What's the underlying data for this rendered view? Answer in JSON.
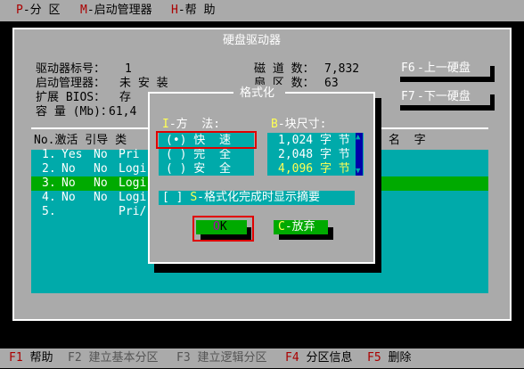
{
  "menu": {
    "item1_key": "P",
    "item1_label": "-分 区",
    "item2_key": "M",
    "item2_label": "-启动管理器",
    "item3_key": "H",
    "item3_label": "-帮 助"
  },
  "disk_panel": {
    "title": "硬盘驱动器",
    "drive_label": "驱动器标号：",
    "drive_value": "1",
    "boot_label": "启动管理器：",
    "boot_value": "未 安 装",
    "bios_label": "扩展 BIOS：",
    "bios_value": "存",
    "capacity_label": "容 量 (Mb)：",
    "capacity_value": "61,4",
    "cylinders_label": "磁 道 数：",
    "cylinders_value": "7,832",
    "heads_label": "扇 区 数：",
    "heads_value": "63",
    "btn_prev_key": "F6",
    "btn_prev_label": "-上一硬盘",
    "btn_next_key": "F7",
    "btn_next_label": "-下一硬盘"
  },
  "partition_list": {
    "header_left": "No.激活 引导 类",
    "header_right": "名  字",
    "rows": [
      {
        "no": "1.",
        "active": "Yes",
        "boot": "No",
        "type": "Pri"
      },
      {
        "no": "2.",
        "active": "No",
        "boot": "No",
        "type": "Logi"
      },
      {
        "no": "3.",
        "active": "No",
        "boot": "No",
        "type": "Logi"
      },
      {
        "no": "4.",
        "active": "No",
        "boot": "No",
        "type": "Logi"
      },
      {
        "no": "5.",
        "active": "",
        "boot": "",
        "type": "Pri/"
      }
    ]
  },
  "format_dialog": {
    "title": "格式化",
    "method_key": "I",
    "method_label": "-方  法:",
    "methods": [
      "(•) 快  速",
      "( ) 完  全",
      "( ) 安  全"
    ],
    "size_key": "B",
    "size_label": "-块尺寸:",
    "sizes": [
      "1,024 字 节",
      "2,048 字 节",
      "4,096 字 节"
    ],
    "summary_checkbox": "[ ]",
    "summary_key": "S",
    "summary_label": "-格式化完成时显示摘要",
    "ok_key": "O",
    "ok_label": "K",
    "cancel_key": "C",
    "cancel_label": "-放弃"
  },
  "statusbar": [
    {
      "key": "F1",
      "label": "帮助",
      "enabled": true
    },
    {
      "key": "F2",
      "label": "建立基本分区",
      "enabled": false
    },
    {
      "key": "F3",
      "label": "建立逻辑分区",
      "enabled": false
    },
    {
      "key": "F4",
      "label": "分区信息",
      "enabled": true
    },
    {
      "key": "F5",
      "label": "删除",
      "enabled": true
    }
  ],
  "colors": {
    "panel_gray": "#aaaaaa",
    "list_cyan": "#00aaaa",
    "selected_green": "#00aa00",
    "hotkey_red": "#aa0000",
    "highlight_frame": "#e00000",
    "scroll_blue": "#0000aa"
  }
}
